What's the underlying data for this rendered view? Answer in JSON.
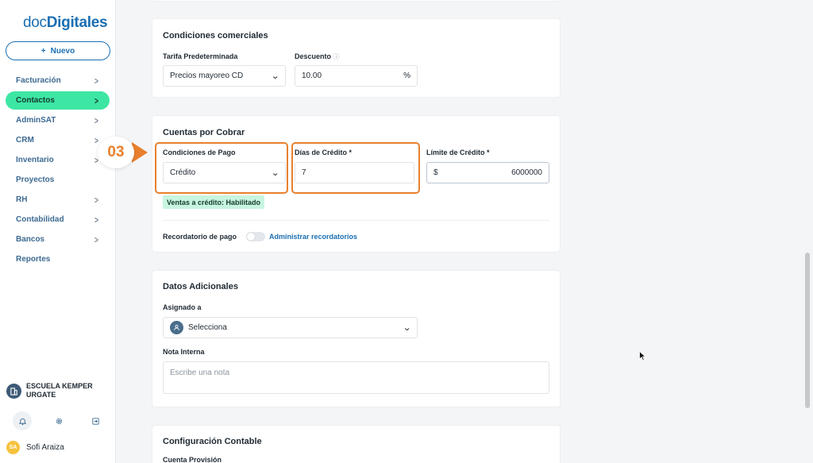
{
  "app": {
    "logo_prefix": "doc",
    "logo_suffix": "Digitales",
    "new_button": "Nuevo"
  },
  "sidebar": {
    "items": [
      {
        "label": "Facturación",
        "has_submenu": true
      },
      {
        "label": "Contactos",
        "has_submenu": true,
        "active": true
      },
      {
        "label": "AdminSAT",
        "has_submenu": true
      },
      {
        "label": "CRM",
        "has_submenu": true
      },
      {
        "label": "Inventario",
        "has_submenu": true
      },
      {
        "label": "Proyectos",
        "has_submenu": false
      },
      {
        "label": "RH",
        "has_submenu": true
      },
      {
        "label": "Contabilidad",
        "has_submenu": true
      },
      {
        "label": "Bancos",
        "has_submenu": true
      },
      {
        "label": "Reportes",
        "has_submenu": false
      }
    ],
    "company": "ESCUELA KEMPER URGATE",
    "user_initials": "SA",
    "user_name": "Sofi Araiza"
  },
  "comerciales": {
    "title": "Condiciones comerciales",
    "tarifa_label": "Tarifa Predeterminada",
    "tarifa_value": "Precios mayoreo CD",
    "descuento_label": "Descuento",
    "descuento_value": "10.00",
    "descuento_suffix": "%"
  },
  "cobrar": {
    "title": "Cuentas por Cobrar",
    "step_number": "03",
    "condiciones_label": "Condiciones de Pago",
    "condiciones_value": "Crédito",
    "dias_label": "Días de Crédito *",
    "dias_value": "7",
    "limite_label": "Límite de Crédito *",
    "limite_prefix": "$",
    "limite_value": "6000000",
    "credit_status": "Ventas a crédito: Habilitado",
    "recordatorio_label": "Recordatorio de pago",
    "recordatorio_enabled": false,
    "recordatorio_link": "Administrar recordatorios"
  },
  "adicionales": {
    "title": "Datos Adicionales",
    "asignado_label": "Asignado a",
    "asignado_value": "Selecciona",
    "nota_label": "Nota Interna",
    "nota_placeholder": "Escribe una nota"
  },
  "contable": {
    "title": "Configuración Contable",
    "cuenta_label": "Cuenta Provisión"
  },
  "colors": {
    "accent": "#1a6fb3",
    "active_nav": "#3ee6a4",
    "highlight": "#e8802e",
    "badge_bg": "#c8f5e0"
  }
}
